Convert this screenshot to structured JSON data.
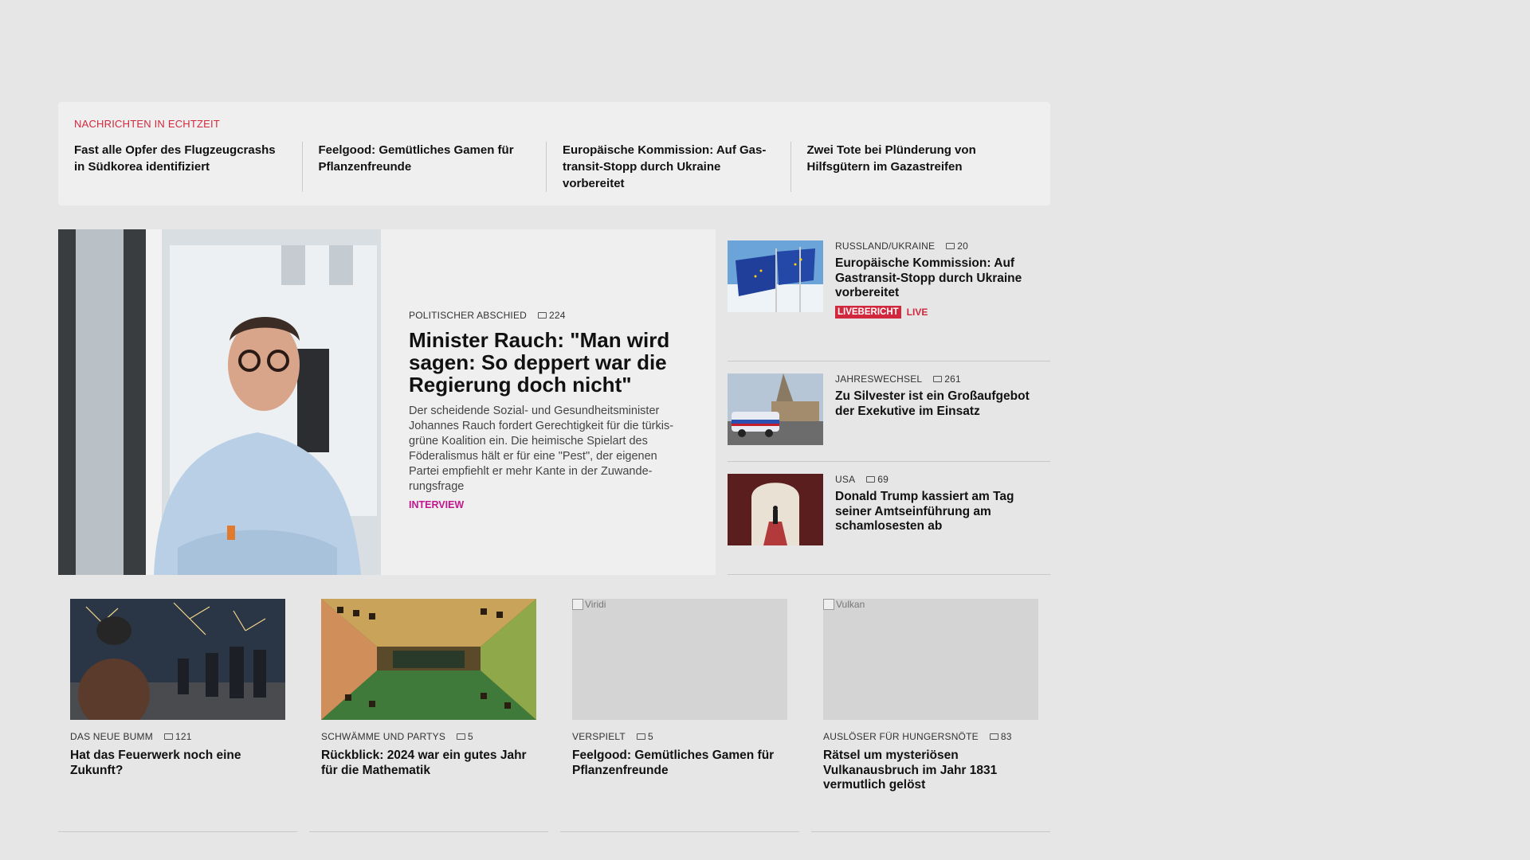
{
  "ticker": {
    "heading": "NACHRICHTEN IN ECHTZEIT",
    "items": [
      "Fast alle Opfer des Flugzeugcrashs in Südkorea identifiziert",
      "Feelgood: Gemütliches Gamen für Pflanzenfreunde",
      "Europäische Kommission: Auf Gas­transit-Stopp durch Ukraine vorbereitet",
      "Zwei Tote bei Plünderung von Hilfsgü­tern im Gazastreifen"
    ]
  },
  "hero": {
    "kicker": "POLITISCHER ABSCHIED",
    "comments": "224",
    "title": "Minister Rauch: \"Man wird sagen: So deppert war die Regierung doch nicht\"",
    "teaser": "Der scheidende Sozial- und Gesundheitsminister Johannes Rauch fordert Gerechtigkeit für die türkis-grüne Koalition ein. Die heimische Spielart des Föderalismus hält er für eine \"Pest\", der eigenen Partei empfiehlt er mehr Kante in der Zuwande­rungsfrage",
    "tag": "INTERVIEW"
  },
  "side": [
    {
      "kicker": "RUSSLAND/UKRAINE",
      "comments": "20",
      "title": "Europäische Kommission: Auf Gastransit-Stopp durch Ukraine vorbereitet",
      "badge": "LIVEBERICHT",
      "live": "LIVE"
    },
    {
      "kicker": "JAHRESWECHSEL",
      "comments": "261",
      "title": "Zu Silvester ist ein Großaufgebot der Exekutive im Einsatz"
    },
    {
      "kicker": "USA",
      "comments": "69",
      "title": "Donald Trump kassiert am Tag seiner Amtseinführung am schamlosesten ab"
    }
  ],
  "cards": [
    {
      "kicker": "DAS NEUE BUMM",
      "comments": "121",
      "title": "Hat das Feuerwerk noch eine Zukunft?"
    },
    {
      "kicker": "SCHWÄMME UND PARTYS",
      "comments": "5",
      "title": "Rückblick: 2024 war ein gutes Jahr für die Mathematik"
    },
    {
      "kicker": "VERSPIELT",
      "comments": "5",
      "title": "Feelgood: Gemütliches Gamen für Pflanzenfreunde",
      "alt": "Viridi"
    },
    {
      "kicker": "AUSLÖSER FÜR HUNGERSNÖTE",
      "comments": "83",
      "title": "Rätsel um mysteriösen Vulkanausbruch im Jahr 1831 vermutlich gelöst",
      "alt": "Vulkan"
    }
  ],
  "colors": {
    "accent_red": "#d1283e",
    "interview_magenta": "#c2178f",
    "page_bg": "#e6e6e6",
    "card_bg": "#efefef"
  }
}
